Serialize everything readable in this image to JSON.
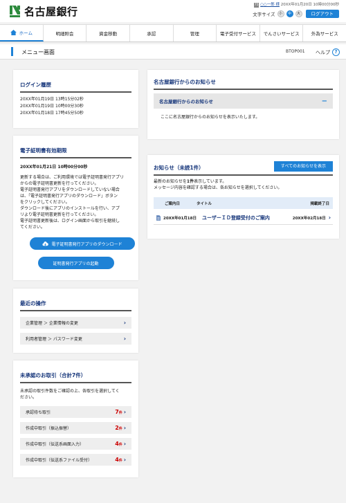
{
  "header": {
    "bank_name": "名古屋銀行",
    "user_badge": "75",
    "user_name": "○○一郎 様",
    "last_login": "20XX年01月20日 10時00分00秒",
    "font_size_label": "文字サイズ",
    "font_sizes": [
      "小",
      "中",
      "大"
    ],
    "logout_label": "ログアウト"
  },
  "nav": {
    "items": [
      "ホーム",
      "明細照会",
      "資金移動",
      "承認",
      "管理",
      "電子受付サービス",
      "でんさいサービス",
      "外為サービス"
    ]
  },
  "page": {
    "title": "メニュー画面",
    "code": "BTOP001",
    "help_label": "ヘルプ",
    "help_icon": "?"
  },
  "login_history": {
    "title": "ログイン履歴",
    "entries": [
      "20XX年01月19日 13時15分02秒",
      "20XX年01月19日 10時00分30秒",
      "20XX年01月18日 17時45分50秒"
    ]
  },
  "cert": {
    "title": "電子証明書有効期限",
    "expiry": "20XX年01月21日 10時00分00秒",
    "desc_lines": [
      "更新する場合は、ご利用環境では電子証明書発行アプリ",
      "からの電子証明書更新を行ってください。",
      "電子証明書発行アプリをダウンロードしていない場合",
      "は、「電子証明書発行アプリのダウンロード」ボタン",
      "をクリックしてください。",
      "ダウンロード後にアプリのインストールを行い、アプ",
      "リより電子証明書更新を行ってください。",
      "電子証明書更新後は、ログイン画面から取引を継続し",
      "てください。"
    ],
    "download_label": "電子証明書発行アプリのダウンロード",
    "launch_label": "証明書発行アプリの起動"
  },
  "recent_ops": {
    "title": "最近の操作",
    "items": [
      "企業管理 ＞ 企業情報の変更",
      "利用者管理 ＞ パスワード変更"
    ]
  },
  "pending": {
    "title": "未承認のお取引（合計7件）",
    "desc_lines": [
      "未承認の取引件数をご確認の上、各取引を選択してく",
      "ださい。"
    ],
    "count_unit": "件",
    "items": [
      {
        "label": "承認待ち取引",
        "count": "7"
      },
      {
        "label": "作成中取引（振込振替）",
        "count": "2"
      },
      {
        "label": "作成中取引（伝送系画面入力）",
        "count": "4"
      },
      {
        "label": "作成中取引（伝送系ファイル受付）",
        "count": "4"
      }
    ]
  },
  "bank_notice": {
    "title": "名古屋銀行からのお知らせ",
    "subheader": "名古屋銀行からのお知らせ",
    "toggle": "−",
    "body": "ここに名古屋銀行からのお知らせを表示いたします。"
  },
  "notices": {
    "title": "お知らせ（未読1件）",
    "all_button": "すべてのお知らせを表示",
    "desc_pre": "最新のお知らせを",
    "desc_count": "1件",
    "desc_post": "表示しています。",
    "desc2": "メッセージ内容を確認する場合は、各お知らせを選択してください。",
    "columns": [
      "ご案内日",
      "タイトル",
      "掲載終了日"
    ],
    "rows": [
      {
        "date": "20XX年01月18日",
        "title": "ユーザーＩＤ登録受付のご案内",
        "end": "20XX年02月18日"
      }
    ]
  },
  "colors": {
    "accent": "#1e82d6",
    "title_navy": "#15357a",
    "count_red": "#cc0000",
    "logo_green": "#2e8b3e"
  }
}
